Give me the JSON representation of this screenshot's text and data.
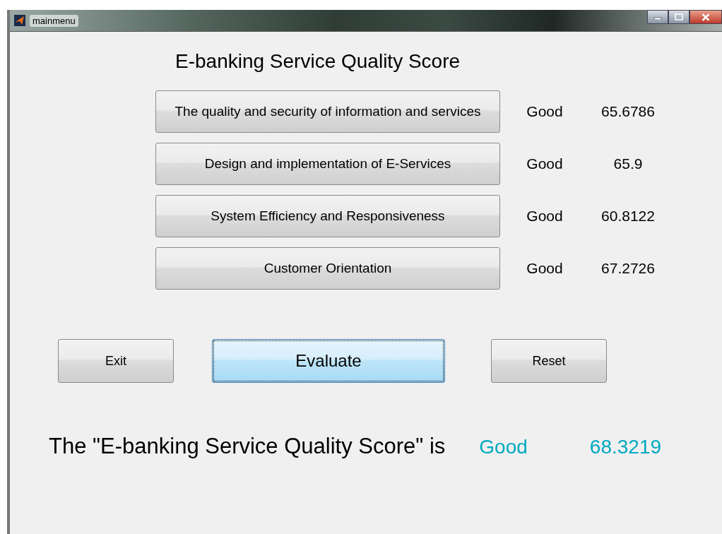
{
  "window": {
    "title": "mainmenu"
  },
  "heading": "E-banking Service Quality Score",
  "criteria": [
    {
      "label": "The quality and security of information and services",
      "rating": "Good",
      "score": "65.6786"
    },
    {
      "label": "Design and implementation of E-Services",
      "rating": "Good",
      "score": "65.9"
    },
    {
      "label": "System Efficiency and Responsiveness",
      "rating": "Good",
      "score": "60.8122"
    },
    {
      "label": "Customer Orientation",
      "rating": "Good",
      "score": "67.2726"
    }
  ],
  "buttons": [
    {
      "label": "Exit",
      "focused": false
    },
    {
      "label": "Evaluate",
      "focused": true
    },
    {
      "label": "Reset",
      "focused": false
    }
  ],
  "result": {
    "label": "The \"E-banking Service Quality Score\" is",
    "rating": "Good",
    "score": "68.3219"
  }
}
